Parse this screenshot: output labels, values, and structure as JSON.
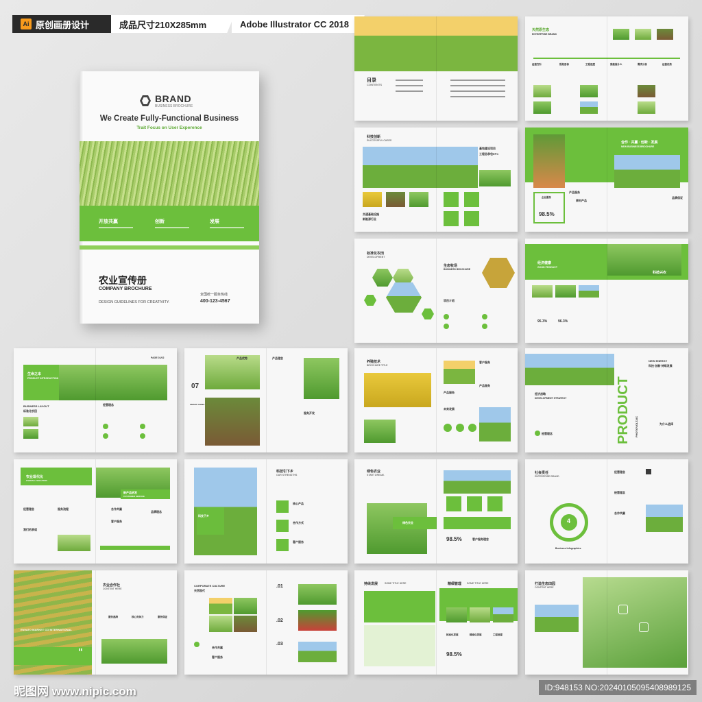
{
  "header": {
    "tag1": "原创画册设计",
    "ai_badge": "Ai",
    "tag2": "成品尺寸210X285mm",
    "tag3": "Adobe Illustrator CC 2018"
  },
  "cover": {
    "brand": "BRAND",
    "brand_sub": "BUSINESS BROCHURE",
    "title": "We Create Fully-Functional Business",
    "subtitle": "Trait Focus on User Experence",
    "band_items": [
      "开放共赢",
      "创新",
      "发展"
    ],
    "cn_title": "农业宣传册",
    "en_title": "COMPANY BROCHURE",
    "guide": "DESIGN GUIDELINES FOR CREATIVITY.",
    "hotline": "全国统一服务热线",
    "phone": "400-123-4567"
  },
  "spreads": {
    "s1": {
      "title": "目录",
      "sub": "CONTENTS"
    },
    "s2": {
      "title": "天然原生态",
      "sub": "ENTERPRISE BRAND",
      "items": [
        "经营方针",
        "规划目标",
        "工程进度",
        "我能做什么",
        "需求分析",
        "经营优势"
      ]
    },
    "s3": {
      "title": "科技创新",
      "sub": "SUCCESSFUL CASES",
      "h2": "基地建设项目",
      "h3": "工程总承包EPC",
      "h4": "交通基础设施",
      "h5": "新能源行业"
    },
    "s4": {
      "title": "合作 · 共赢 · 创新 · 发展",
      "sub": "NEW BUSINESS BROCHURE",
      "h2": "企业服务",
      "h3": "产品服务",
      "h4": "原材产品",
      "h5": "品牌保证",
      "pct": "98.5%"
    },
    "s5": {
      "title": "标准化农田",
      "sub": "DEVELOPMENT",
      "h2": "生态牧场",
      "h3": "BUSINESS BROCHURE",
      "h4": "项目介绍"
    },
    "s6": {
      "title": "经济健康",
      "sub": "GOOD PRODUCT",
      "h2": "科技兴农",
      "h3": "ACOST OF BUSINESS",
      "p1": "95.3%",
      "p2": "96.3%"
    },
    "s7": {
      "title": "生命之本",
      "sub": "PRODUCT INTRODUCTION",
      "h2": "BUSINESS LAYOUT",
      "h3": "标准化农田",
      "h4": "经营理念",
      "page": "PAGE 01/02"
    },
    "s8": {
      "title": "07",
      "sub": "SMART GOING DIGITAL GREEN",
      "h2": "产品优势",
      "h3": "产品理念",
      "h4": "服务开发"
    },
    "s9": {
      "title": "养殖技术",
      "sub": "BROCHURE TITLE",
      "h2": "客户服务",
      "h3": "产品服务",
      "h4": "产品服务",
      "h5": "未来发展"
    },
    "s10": {
      "title": "PRODUCT",
      "sub": "PHOTOVOLTAIC",
      "h2": "NEW ENERGY",
      "h3": "科技·创新·持续发展",
      "h4": "经济战略",
      "h5": "DEVELOPMENT STRATEGY",
      "h6": "经营理念",
      "h7": "为什么选择"
    },
    "s11": {
      "title": "农业现代化",
      "sub": "OVERALL SOLUTION",
      "h2": "新产品研发",
      "h3": "CUSTOMER SERVICE",
      "h4": "经营理念",
      "h5": "服务流程",
      "h6": "合作共赢",
      "h7": "客户服务",
      "h8": "我们的承诺",
      "h9": "品牌理念"
    },
    "s12": {
      "title": "科技引下乡",
      "sub": "OUR STRENGTHS",
      "h2": "科技下乡",
      "h3": "核心产品",
      "h4": "合作方式",
      "h5": "客户服务"
    },
    "s13": {
      "title": "绿色农业",
      "sub": "START DREAM.",
      "h2": "绿色农业",
      "h3": "98.5%",
      "h4": "客户服务理念"
    },
    "s14": {
      "title": "社会责任",
      "sub": "ENTERPRISE BRAND",
      "h2": "4",
      "h3": "Business Infographics",
      "h4": "经营理念",
      "h5": "经营理念",
      "h6": "合作共赢"
    },
    "s15": {
      "title": "农业合作社",
      "sub": "CONTENT HERE",
      "h2": "ENVATO MARKET CO INTERNATIONAL",
      "h3": "服务品牌",
      "h4": "核心竞争力",
      "h5": "服务保证",
      "h6": "“"
    },
    "s16": {
      "title": "CORPORATE CULTURE",
      "sub": "天然现代",
      "h2": ".01",
      "h3": ".02",
      "h4": ".03",
      "h5": "产品优势",
      "h6": "产品理念",
      "h7": "服务开发",
      "h8": "合作共赢",
      "h9": "客户服务"
    },
    "s17": {
      "title": "持续发展",
      "sub": "SOME TITLE HERE",
      "h2": "精细管理",
      "h3": "SOME TITLE HERE",
      "h4": "98.5%",
      "h5": "标准化发展",
      "h6": "精准化发展",
      "h7": "工程进度"
    },
    "s18": {
      "title": "打造生态田园",
      "sub": "CONTENT HERE"
    }
  },
  "watermark": {
    "left": "昵图网 www.nipic.com",
    "right": "ID:948153 NO:20240105095408989125"
  }
}
